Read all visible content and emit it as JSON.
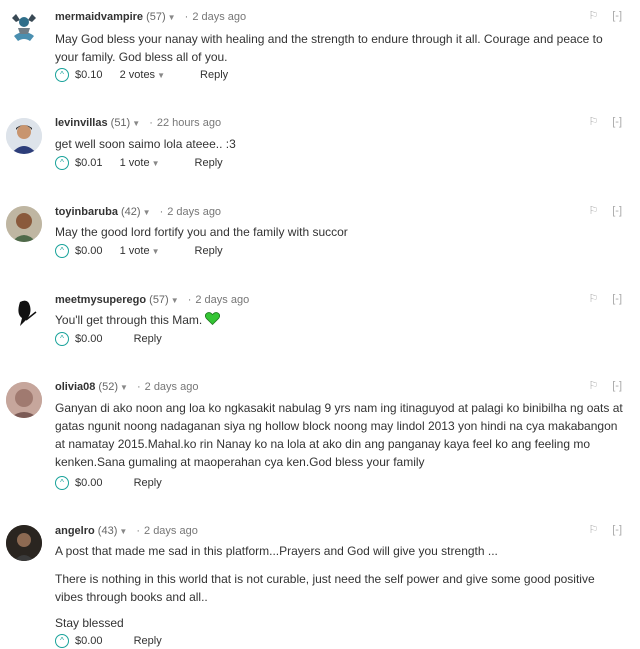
{
  "comments": [
    {
      "username": "mermaidvampire",
      "reputation": "(57)",
      "time": "2 days ago",
      "paragraphs": [
        "May God bless your nanay with healing and the strength to endure through it all. Courage and peace to your family. God bless all of you."
      ],
      "payout": "$0.10",
      "votes": "2 votes",
      "reply": "Reply"
    },
    {
      "username": "levinvillas",
      "reputation": "(51)",
      "time": "22 hours ago",
      "paragraphs": [
        "get well soon saimo lola ateee.. :3"
      ],
      "payout": "$0.01",
      "votes": "1 vote",
      "reply": "Reply"
    },
    {
      "username": "toyinbaruba",
      "reputation": "(42)",
      "time": "2 days ago",
      "paragraphs": [
        "May the good lord fortify you and the family with succor"
      ],
      "payout": "$0.00",
      "votes": "1 vote",
      "reply": "Reply"
    },
    {
      "username": "meetmysuperego",
      "reputation": "(57)",
      "time": "2 days ago",
      "paragraphs": [
        "You'll get through this Mam."
      ],
      "payout": "$0.00",
      "reply": "Reply"
    },
    {
      "username": "olivia08",
      "reputation": "(52)",
      "time": "2 days ago",
      "paragraphs": [
        "Ganyan di ako noon ang loa ko ngkasakit nabulag 9 yrs nam ing itinaguyod at palagi ko binibilha ng oats at gatas ngunit noong nadaganan siya ng hollow block noong may lindol 2013 yon hindi na cya makabangon at namatay 2015.Mahal.ko rin Nanay ko na lola at ako din ang panganay kaya feel ko ang feeling mo kenken.Sana gumaling at maoperahan cya ken.God bless your family"
      ],
      "payout": "$0.00",
      "reply": "Reply"
    },
    {
      "username": "angelro",
      "reputation": "(43)",
      "time": "2 days ago",
      "paragraphs": [
        "A post that made me sad in this platform...Prayers and God will give you strength ...",
        "There is nothing in this world that is not curable, just need the self power and give some good positive vibes through books and all..",
        "Stay blessed"
      ],
      "payout": "$0.00",
      "reply": "Reply"
    }
  ],
  "labels": {
    "flag": "⚐",
    "collapse": "[-]",
    "upvote": "^"
  },
  "colors": {
    "accent": "#1aa39b",
    "heart": "#34c534"
  }
}
